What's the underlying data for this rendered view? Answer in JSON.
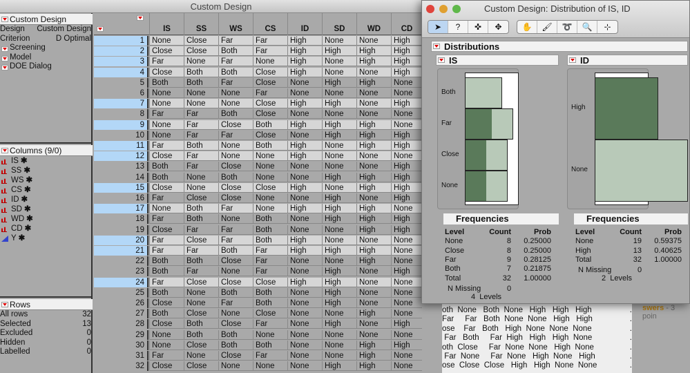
{
  "window": {
    "title": "Custom Design"
  },
  "left": {
    "custom_design": {
      "title": "Custom Design",
      "design_label": "Design",
      "design_value": "Custom Design",
      "criterion_label": "Criterion",
      "criterion_value": "D Optimal",
      "subsections": [
        "Screening",
        "Model",
        "DOE Dialog"
      ]
    },
    "columns": {
      "title": "Columns (9/0)",
      "items": [
        {
          "name": "IS",
          "type": "nominal"
        },
        {
          "name": "SS",
          "type": "nominal"
        },
        {
          "name": "WS",
          "type": "nominal"
        },
        {
          "name": "CS",
          "type": "nominal"
        },
        {
          "name": "ID",
          "type": "nominal"
        },
        {
          "name": "SD",
          "type": "nominal"
        },
        {
          "name": "WD",
          "type": "nominal"
        },
        {
          "name": "CD",
          "type": "nominal"
        },
        {
          "name": "Y",
          "type": "continuous"
        }
      ],
      "marker": "✱"
    },
    "rows": {
      "title": "Rows",
      "items": [
        {
          "label": "All rows",
          "value": "32"
        },
        {
          "label": "Selected",
          "value": "13"
        },
        {
          "label": "Excluded",
          "value": "0"
        },
        {
          "label": "Hidden",
          "value": "0"
        },
        {
          "label": "Labelled",
          "value": "0"
        }
      ]
    }
  },
  "table": {
    "headers": [
      "IS",
      "SS",
      "WS",
      "CS",
      "ID",
      "SD",
      "WD",
      "CD"
    ],
    "selected_rows": [
      1,
      2,
      3,
      4,
      7,
      9,
      11,
      12,
      15,
      17,
      20,
      21,
      24
    ],
    "rows": [
      [
        "None",
        "Close",
        "Far",
        "Far",
        "High",
        "None",
        "None",
        "High"
      ],
      [
        "Close",
        "Close",
        "Both",
        "Far",
        "High",
        "High",
        "High",
        "High"
      ],
      [
        "Far",
        "None",
        "Far",
        "None",
        "High",
        "None",
        "High",
        "High"
      ],
      [
        "Close",
        "Both",
        "Both",
        "Close",
        "High",
        "None",
        "None",
        "High"
      ],
      [
        "Both",
        "Both",
        "Far",
        "Close",
        "None",
        "High",
        "High",
        "None"
      ],
      [
        "None",
        "None",
        "None",
        "Far",
        "None",
        "None",
        "None",
        "None"
      ],
      [
        "None",
        "None",
        "None",
        "Close",
        "High",
        "High",
        "None",
        "High"
      ],
      [
        "Far",
        "Far",
        "Both",
        "Close",
        "None",
        "None",
        "None",
        "None"
      ],
      [
        "None",
        "Far",
        "Close",
        "Both",
        "High",
        "High",
        "High",
        "None"
      ],
      [
        "None",
        "Far",
        "Far",
        "Close",
        "None",
        "High",
        "High",
        "High"
      ],
      [
        "Far",
        "Both",
        "None",
        "Both",
        "High",
        "None",
        "High",
        "High"
      ],
      [
        "Close",
        "Far",
        "None",
        "None",
        "High",
        "None",
        "None",
        "None"
      ],
      [
        "Both",
        "Far",
        "Close",
        "None",
        "None",
        "None",
        "None",
        "High"
      ],
      [
        "Both",
        "None",
        "Both",
        "None",
        "None",
        "High",
        "High",
        "High"
      ],
      [
        "Close",
        "None",
        "Close",
        "Close",
        "High",
        "None",
        "High",
        "High"
      ],
      [
        "Far",
        "Close",
        "Close",
        "None",
        "None",
        "High",
        "None",
        "High"
      ],
      [
        "None",
        "Both",
        "Far",
        "None",
        "High",
        "High",
        "High",
        "None"
      ],
      [
        "Far",
        "Both",
        "None",
        "Both",
        "None",
        "High",
        "High",
        "High"
      ],
      [
        "Close",
        "Far",
        "Far",
        "Both",
        "None",
        "None",
        "High",
        "High"
      ],
      [
        "Far",
        "Close",
        "Far",
        "Both",
        "High",
        "None",
        "None",
        "None"
      ],
      [
        "Far",
        "Far",
        "Both",
        "Far",
        "High",
        "High",
        "High",
        "None"
      ],
      [
        "Both",
        "Both",
        "Close",
        "Far",
        "None",
        "None",
        "High",
        "None"
      ],
      [
        "Both",
        "Far",
        "None",
        "Far",
        "None",
        "High",
        "None",
        "High"
      ],
      [
        "Far",
        "Close",
        "Close",
        "Close",
        "High",
        "High",
        "None",
        "None"
      ],
      [
        "Both",
        "None",
        "Both",
        "Both",
        "None",
        "High",
        "None",
        "None"
      ],
      [
        "Close",
        "None",
        "Far",
        "Both",
        "None",
        "High",
        "None",
        "None"
      ],
      [
        "Both",
        "Close",
        "None",
        "Close",
        "None",
        "None",
        "High",
        "None"
      ],
      [
        "Close",
        "Both",
        "Close",
        "Far",
        "None",
        "High",
        "None",
        "High"
      ],
      [
        "None",
        "Both",
        "Both",
        "None",
        "None",
        "None",
        "None",
        "None"
      ],
      [
        "None",
        "Close",
        "Both",
        "Both",
        "None",
        "None",
        "High",
        "High"
      ],
      [
        "Far",
        "None",
        "Close",
        "Far",
        "None",
        "None",
        "High",
        "None"
      ],
      [
        "Close",
        "Close",
        "None",
        "None",
        "None",
        "High",
        "High",
        "None"
      ]
    ]
  },
  "dialog": {
    "title": "Custom Design: Distribution of IS, ID",
    "tools": [
      "arrow",
      "help",
      "crosshair",
      "move",
      "hand",
      "brush",
      "lasso",
      "magnifier",
      "xy-scale"
    ],
    "distributions_title": "Distributions",
    "colors": {
      "selected": "#5a7a5a",
      "unselected": "#b8c9b8"
    },
    "frequencies_title": "Frequencies",
    "headers": [
      "Level",
      "Count",
      "Prob"
    ],
    "is": {
      "title": "IS",
      "levels": [
        {
          "level": "None",
          "count": "8",
          "prob": "0.25000",
          "selected": 4
        },
        {
          "level": "Close",
          "count": "8",
          "prob": "0.25000",
          "selected": 4
        },
        {
          "level": "Far",
          "count": "9",
          "prob": "0.28125",
          "selected": 5
        },
        {
          "level": "Both",
          "count": "7",
          "prob": "0.21875",
          "selected": 0
        }
      ],
      "total": {
        "label": "Total",
        "count": "32",
        "prob": "1.00000"
      },
      "n_missing_label": "N Missing",
      "n_missing": "0",
      "levels_text": "4  Levels"
    },
    "id": {
      "title": "ID",
      "levels": [
        {
          "level": "None",
          "count": "19",
          "prob": "0.59375",
          "selected": 0
        },
        {
          "level": "High",
          "count": "13",
          "prob": "0.40625",
          "selected": 13
        }
      ],
      "total": {
        "label": "Total",
        "count": "32",
        "prob": "1.00000"
      },
      "n_missing_label": "N Missing",
      "n_missing": "0",
      "levels_text": "2  Levels"
    }
  },
  "background": {
    "lines": [
      "oth  None   Both  None   High   High   High",
      "Far     Far   Both  None  None   High   High",
      "ose    Far   Both   High  None  None  None",
      " Far   Both     Far  High   High   High  None",
      "oth  Close     Far  None  None   High  None",
      " Far  None     Far  None   High  None   High",
      "ose  Close  Close   High   High  None  None"
    ],
    "dot": ".",
    "answers_bold": "swers",
    "answers_rest": " - 3 poin"
  }
}
